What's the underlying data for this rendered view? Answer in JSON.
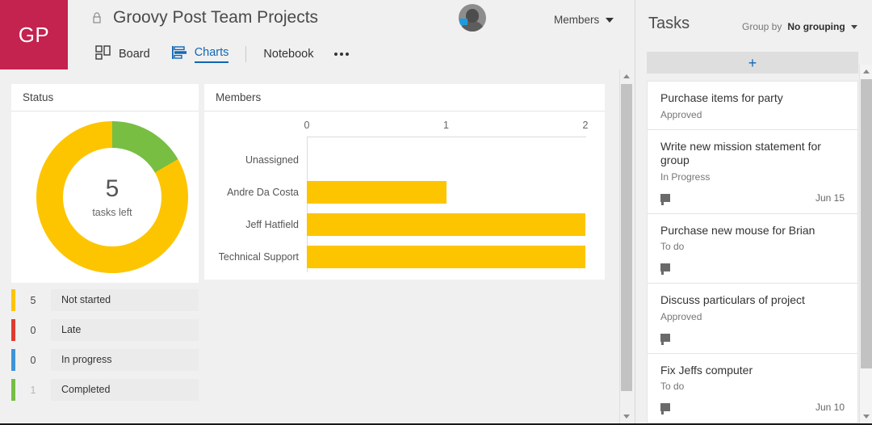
{
  "header": {
    "group_initials": "GP",
    "group_color": "#c4224f",
    "lock_icon": "lock-icon",
    "plan_title": "Groovy Post Team Projects",
    "members_dropdown_label": "Members",
    "avatar": "user-avatar"
  },
  "tabs": [
    {
      "label": "Board",
      "icon": "board-icon",
      "active": false
    },
    {
      "label": "Charts",
      "icon": "charts-icon",
      "active": true
    },
    {
      "label": "Notebook",
      "icon": "",
      "active": false
    }
  ],
  "more_button": "ellipsis-icon",
  "status_panel": {
    "title": "Status",
    "center_value": "5",
    "center_label": "tasks left",
    "legend": [
      {
        "count": "5",
        "label": "Not started",
        "color": "#fdc500"
      },
      {
        "count": "0",
        "label": "Late",
        "color": "#e03b2f"
      },
      {
        "count": "0",
        "label": "In progress",
        "color": "#3f94d8"
      },
      {
        "count": "1",
        "label": "Completed",
        "color": "#77be43"
      }
    ]
  },
  "members_panel": {
    "title": "Members"
  },
  "chart_data": [
    {
      "type": "pie",
      "title": "Status",
      "subtitle": "5 tasks left",
      "labels": [
        "Not started",
        "Late",
        "In progress",
        "Completed"
      ],
      "values": [
        5,
        0,
        0,
        1
      ],
      "colors": [
        "#fdc500",
        "#e03b2f",
        "#3f94d8",
        "#77be43"
      ],
      "donut": true,
      "legend": "bottom",
      "center_text": "5 tasks left"
    },
    {
      "type": "bar",
      "orientation": "horizontal",
      "title": "Members",
      "categories": [
        "Unassigned",
        "Andre Da Costa",
        "Jeff Hatfield",
        "Technical Support"
      ],
      "values": [
        0,
        1,
        2,
        2
      ],
      "xlabel": "",
      "ylabel": "",
      "xlim": [
        0,
        2
      ],
      "xticks": [
        "0",
        "1",
        "2"
      ],
      "bar_color": "#fdc500",
      "grid": false,
      "legend": "none"
    }
  ],
  "tasks_panel": {
    "title": "Tasks",
    "group_by_label": "Group by",
    "group_by_value": "No grouping",
    "add_button": "+",
    "tasks": [
      {
        "title": "Purchase items for party",
        "status": "Approved",
        "has_comment": false,
        "date": ""
      },
      {
        "title": "Write new mission statement for group",
        "status": "In Progress",
        "has_comment": true,
        "date": "Jun 15"
      },
      {
        "title": "Purchase new mouse for Brian",
        "status": "To do",
        "has_comment": true,
        "date": ""
      },
      {
        "title": "Discuss particulars of project",
        "status": "Approved",
        "has_comment": true,
        "date": ""
      },
      {
        "title": "Fix Jeffs computer",
        "status": "To do",
        "has_comment": true,
        "date": "Jun 10"
      }
    ]
  },
  "colors": {
    "accent_blue": "#1166b4",
    "yellow": "#fdc500",
    "green": "#77be43",
    "red": "#e03b2f",
    "blue": "#3f94d8",
    "brand": "#c4224f"
  }
}
